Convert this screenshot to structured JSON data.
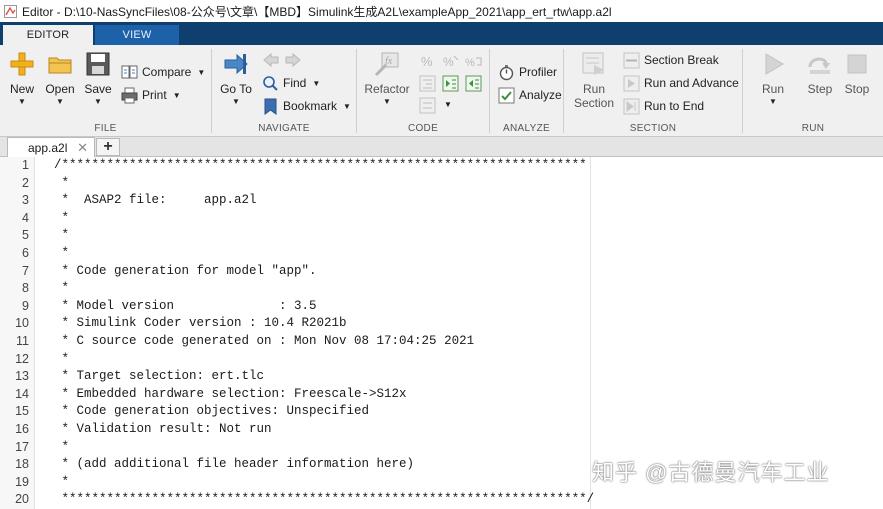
{
  "window": {
    "title": "Editor - D:\\10-NasSyncFiles\\08-公众号\\文章\\【MBD】Simulink生成A2L\\exampleApp_2021\\app_ert_rtw\\app.a2l"
  },
  "ribbon_tabs": [
    {
      "label": "EDITOR",
      "active": true
    },
    {
      "label": "VIEW",
      "active": false
    }
  ],
  "ribbon": {
    "file": {
      "label": "FILE",
      "new": "New",
      "open": "Open",
      "save": "Save",
      "compare": "Compare",
      "print": "Print"
    },
    "navigate": {
      "label": "NAVIGATE",
      "go_to": "Go To",
      "find": "Find",
      "bookmark": "Bookmark"
    },
    "code": {
      "label": "CODE",
      "refactor": "Refactor"
    },
    "analyze": {
      "label": "ANALYZE",
      "profiler": "Profiler",
      "analyze": "Analyze"
    },
    "section": {
      "label": "SECTION",
      "run_section_line1": "Run",
      "run_section_line2": "Section",
      "section_break": "Section Break",
      "run_and_advance": "Run and Advance",
      "run_to_end": "Run to End"
    },
    "run": {
      "label": "RUN",
      "run": "Run",
      "step": "Step",
      "stop": "Stop"
    }
  },
  "doc_tabs": [
    {
      "label": "app.a2l"
    }
  ],
  "add_tab": "+",
  "editor": {
    "lines": [
      {
        "no": "1",
        "text": "/**********************************************************************"
      },
      {
        "no": "2",
        "text": " *"
      },
      {
        "no": "3",
        "text": " *  ASAP2 file:     app.a2l"
      },
      {
        "no": "4",
        "text": " *"
      },
      {
        "no": "5",
        "text": " *"
      },
      {
        "no": "6",
        "text": " *"
      },
      {
        "no": "7",
        "text": " * Code generation for model \"app\"."
      },
      {
        "no": "8",
        "text": " *"
      },
      {
        "no": "9",
        "text": " * Model version              : 3.5"
      },
      {
        "no": "10",
        "text": " * Simulink Coder version : 10.4 R2021b"
      },
      {
        "no": "11",
        "text": " * C source code generated on : Mon Nov 08 17:04:25 2021"
      },
      {
        "no": "12",
        "text": " *"
      },
      {
        "no": "13",
        "text": " * Target selection: ert.tlc"
      },
      {
        "no": "14",
        "text": " * Embedded hardware selection: Freescale->S12x"
      },
      {
        "no": "15",
        "text": " * Code generation objectives: Unspecified"
      },
      {
        "no": "16",
        "text": " * Validation result: Not run"
      },
      {
        "no": "17",
        "text": " *"
      },
      {
        "no": "18",
        "text": " * (add additional file header information here)"
      },
      {
        "no": "19",
        "text": " *"
      },
      {
        "no": "20",
        "text": " **********************************************************************/"
      }
    ]
  },
  "watermark": "知乎 @古德曼汽车工业",
  "colors": {
    "tab_bar": "#0f3f6e",
    "inactive_tab": "#1d61a8",
    "ribbon_bg": "#f0f0f0"
  }
}
